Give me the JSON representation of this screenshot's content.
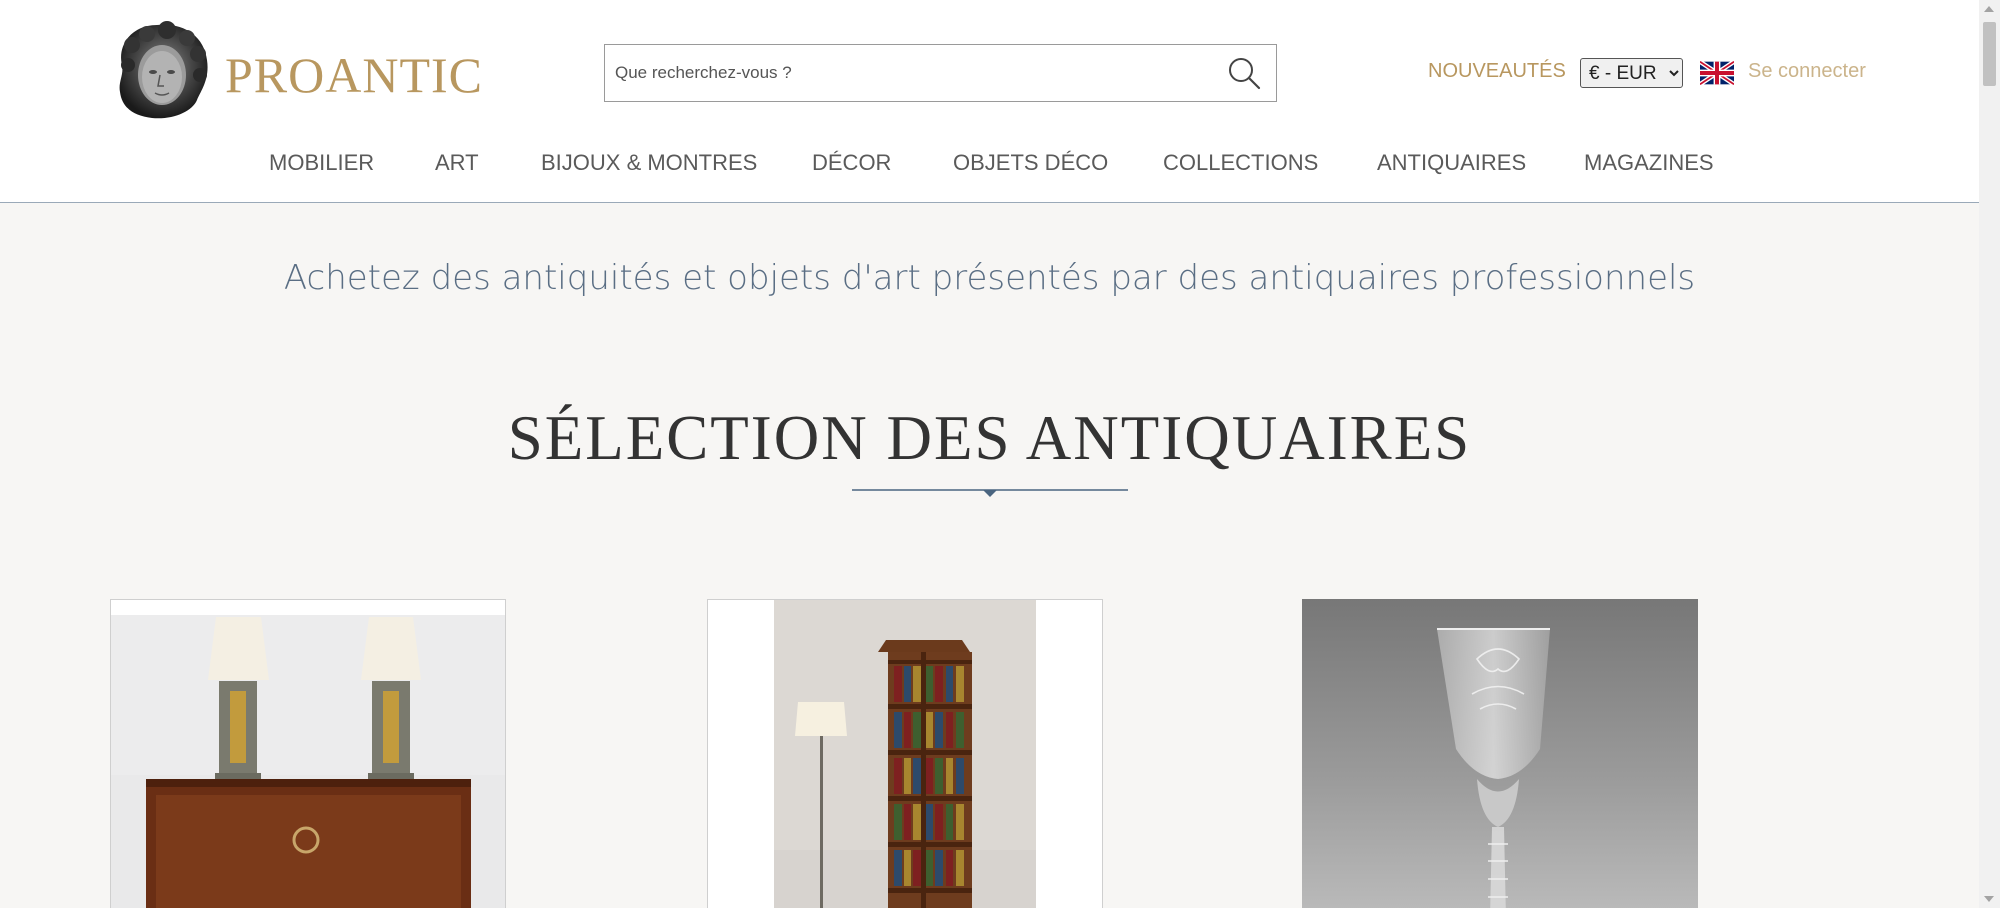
{
  "header": {
    "logo_text": "PROANTIC",
    "search": {
      "placeholder": "Que recherchez-vous ?",
      "value": ""
    },
    "nouveautes_label": "NOUVEAUTÉS",
    "currency": {
      "selected": "€ - EUR",
      "options": [
        "€ - EUR"
      ]
    },
    "language_flag": "uk-flag-icon",
    "login_label": "Se connecter"
  },
  "nav": {
    "items": [
      {
        "label": "MOBILIER"
      },
      {
        "label": "ART"
      },
      {
        "label": "BIJOUX & MONTRES"
      },
      {
        "label": "DÉCOR"
      },
      {
        "label": "OBJETS DÉCO"
      },
      {
        "label": "COLLECTIONS"
      },
      {
        "label": "ANTIQUAIRES"
      },
      {
        "label": "MAGAZINES"
      }
    ]
  },
  "main": {
    "tagline": "Achetez des antiquités et objets d'art présentés par des antiquaires professionnels",
    "section_title": "SÉLECTION DES ANTIQUAIRES",
    "products": [
      {
        "image": "art-deco-sideboard-with-lamps"
      },
      {
        "image": "revolving-bookcase-with-floor-lamp"
      },
      {
        "image": "engraved-crystal-goblet"
      }
    ]
  },
  "colors": {
    "brand_gold": "#b8975f",
    "nav_text": "#5a5a5a",
    "tagline": "#5a6e84",
    "divider": "#4a6580",
    "background": "#f7f6f4"
  }
}
